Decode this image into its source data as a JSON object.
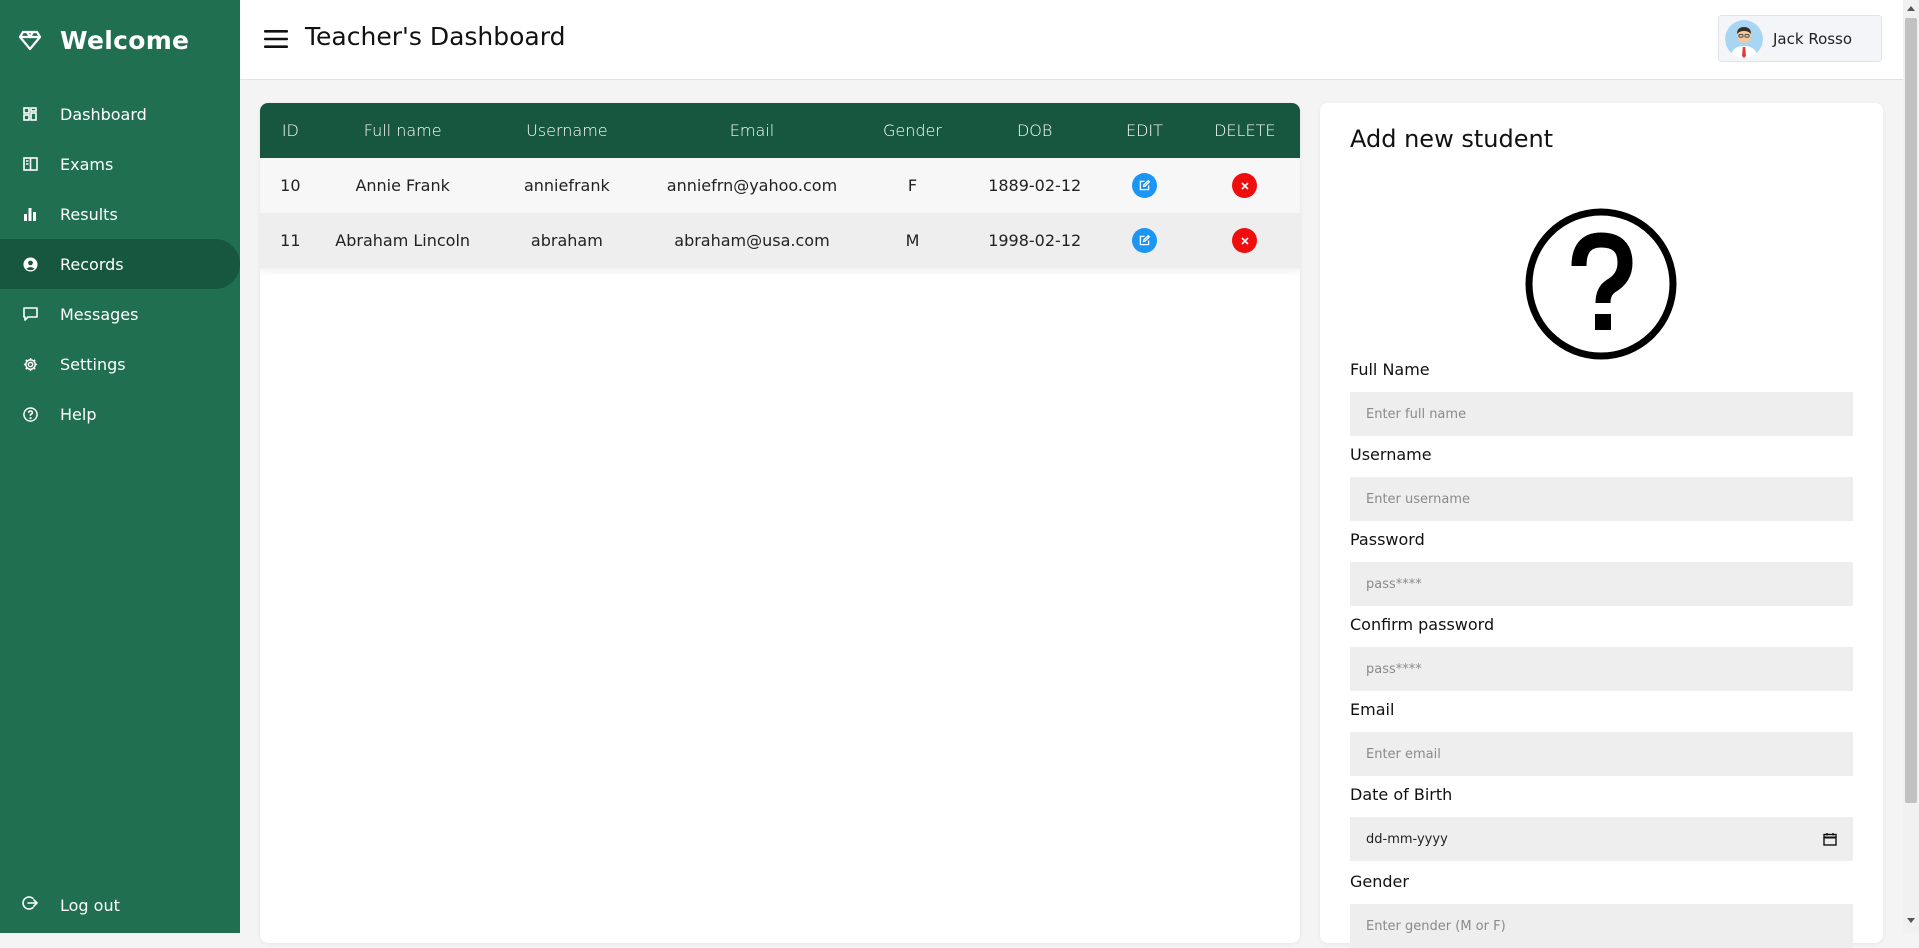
{
  "sidebar": {
    "brand": "Welcome",
    "items": [
      {
        "label": "Dashboard",
        "icon": "grid-icon"
      },
      {
        "label": "Exams",
        "icon": "book-icon"
      },
      {
        "label": "Results",
        "icon": "bar-chart-icon"
      },
      {
        "label": "Records",
        "icon": "user-circle-icon",
        "active": true
      },
      {
        "label": "Messages",
        "icon": "message-icon"
      },
      {
        "label": "Settings",
        "icon": "gear-icon"
      },
      {
        "label": "Help",
        "icon": "help-icon"
      }
    ],
    "logout": "Log out"
  },
  "header": {
    "title": "Teacher's Dashboard",
    "user_name": "Jack Rosso"
  },
  "table": {
    "columns": [
      "ID",
      "Full name",
      "Username",
      "Email",
      "Gender",
      "DOB",
      "EDIT",
      "DELETE"
    ],
    "rows": [
      {
        "id": "10",
        "full_name": "Annie Frank",
        "username": "anniefrank",
        "email": "anniefrn@yahoo.com",
        "gender": "F",
        "dob": "1889-02-12"
      },
      {
        "id": "11",
        "full_name": "Abraham Lincoln",
        "username": "abraham",
        "email": "abraham@usa.com",
        "gender": "M",
        "dob": "1998-02-12"
      }
    ]
  },
  "form": {
    "title": "Add new student",
    "fields": [
      {
        "label": "Full Name",
        "placeholder": "Enter full name"
      },
      {
        "label": "Username",
        "placeholder": "Enter username"
      },
      {
        "label": "Password",
        "placeholder": "pass****"
      },
      {
        "label": "Confirm password",
        "placeholder": "pass****"
      },
      {
        "label": "Email",
        "placeholder": "Enter email"
      },
      {
        "label": "Date of Birth",
        "placeholder": "dd-mm-yyyy"
      },
      {
        "label": "Gender",
        "placeholder": "Enter gender (M or F)"
      }
    ]
  },
  "colors": {
    "sidebar": "#1f6f50",
    "sidebar_active": "#17573f",
    "table_header": "#17573f",
    "edit": "#1b96f3",
    "delete": "#ef0d0d"
  }
}
